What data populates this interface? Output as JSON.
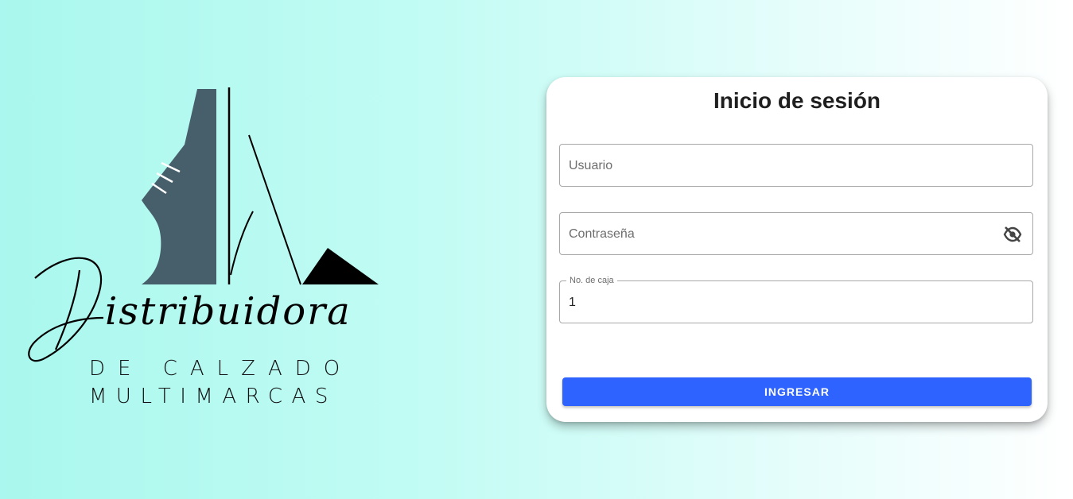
{
  "logo": {
    "script_word": "Distribuidora",
    "line1": "DE CALZADO",
    "line2": "MULTIMARCAS",
    "icon": "shoe-heel-logo-icon",
    "colors": {
      "shoe": "#475f6a",
      "ink": "#000000"
    }
  },
  "login": {
    "title": "Inicio de sesión",
    "username": {
      "placeholder": "Usuario",
      "value": ""
    },
    "password": {
      "placeholder": "Contraseña",
      "value": "",
      "toggle_icon": "eye-off-icon"
    },
    "register": {
      "label": "No. de caja",
      "value": "1"
    },
    "submit_label": "INGRESAR"
  },
  "colors": {
    "accent": "#2f63ff",
    "background_start": "#a9f7ee",
    "background_end": "#ffffff"
  }
}
